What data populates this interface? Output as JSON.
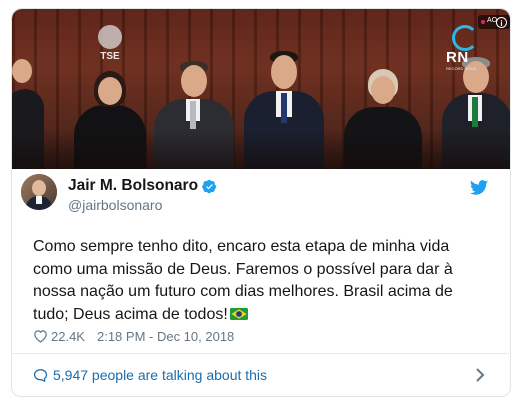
{
  "media": {
    "watermark_left": "TSE",
    "watermark_right": "RN",
    "watermark_right_sub": "RECORD NEWS",
    "ad_badge": "AO",
    "info_icon": "info-icon"
  },
  "author": {
    "display_name": "Jair M. Bolsonaro",
    "handle": "@jairbolsonaro",
    "verified_icon": "verified-badge-icon"
  },
  "tweet": {
    "text": "Como sempre tenho dito, encaro esta etapa de minha vida como uma missão de Deus. Faremos o possível para dar à nossa nação um futuro com dias melhores. Brasil acima de tudo; Deus acima de todos!",
    "emoji": "brazil-flag-icon",
    "likes": "22.4K",
    "timestamp": "2:18 PM - Dec 10, 2018"
  },
  "footer": {
    "conversation": "5,947 people are talking about this"
  },
  "colors": {
    "twitter_blue": "#1da1f2",
    "link_blue": "#1b6dad",
    "muted_text": "#657786",
    "border": "#dfe6ea"
  }
}
